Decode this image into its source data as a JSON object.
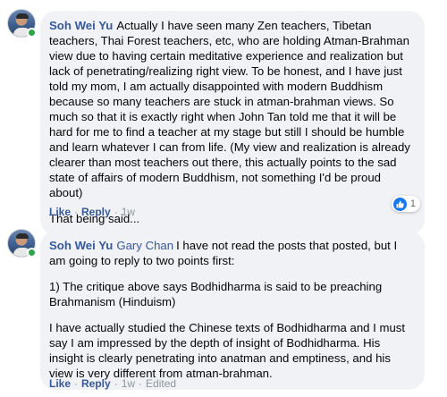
{
  "comments": [
    {
      "author": "Soh Wei Yu",
      "tag": "",
      "paragraphs": [
        "Actually I have seen many Zen teachers, Tibetan teachers, Thai Forest teachers, etc, who are holding Atman-Brahman view due to having certain meditative experience and realization but lack of penetrating/realizing right view. To be honest, and I have just told my mom, I am actually disappointed with modern Buddhism because so many teachers are stuck in atman-brahman views. So much so that it is exactly right when John Tan told me that it will be hard for me to find a teacher at my stage but still I should be humble and learn whatever I can from life. (My view and realization is already clearer than most teachers out there, this actually points to the sad state of affairs of modern Buddhism, not something I'd be proud about)",
        "That being said..."
      ],
      "actions": {
        "like": "Like",
        "reply": "Reply",
        "time": "1w"
      },
      "reactions": {
        "count": "1",
        "icon": "like-icon",
        "color": "#1877f2"
      }
    },
    {
      "author": "Soh Wei Yu",
      "tag": "Gary Chan",
      "paragraphs": [
        "I have not read the posts that posted, but I am going to reply to two points first:",
        "1) The critique above says Bodhidharma is said to be preaching Brahmanism (Hinduism)",
        "I have actually studied the Chinese texts of Bodhidharma and I must say I am impressed by the depth of insight of Bodhidharma. His insight is clearly penetrating into anatman and emptiness, and his view is very different from atman-brahman."
      ],
      "actions": {
        "like": "Like",
        "reply": "Reply",
        "time": "1w",
        "edited": "Edited"
      }
    }
  ],
  "colors": {
    "link": "#385898",
    "bubble": "#f0f2f5",
    "online": "#31a24c"
  }
}
